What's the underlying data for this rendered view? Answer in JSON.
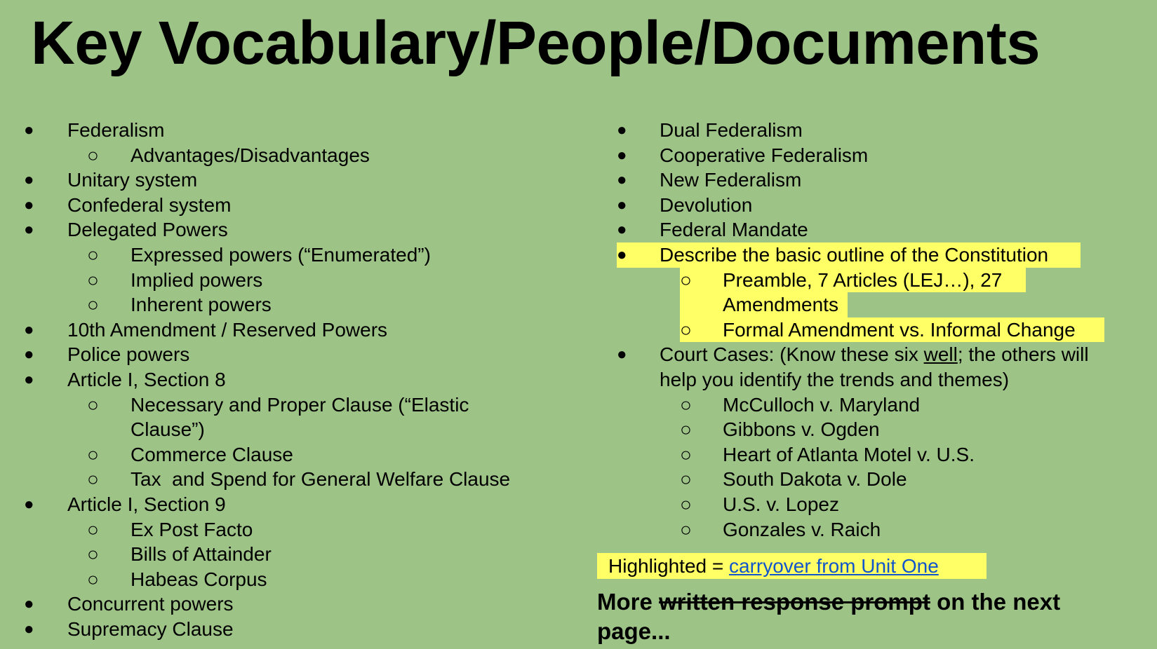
{
  "title": "Key Vocabulary/People/Documents",
  "colors": {
    "background": "#9dc386",
    "highlight": "#ffff66",
    "link": "#1155cc"
  },
  "bullets": {
    "level1": "●",
    "level2": "○"
  },
  "left_column": [
    {
      "level": 1,
      "text": "Federalism"
    },
    {
      "level": 2,
      "text": "Advantages/Disadvantages"
    },
    {
      "level": 1,
      "text": "Unitary system"
    },
    {
      "level": 1,
      "text": "Confederal system"
    },
    {
      "level": 1,
      "text": "Delegated Powers"
    },
    {
      "level": 2,
      "text": "Expressed powers (“Enumerated”)"
    },
    {
      "level": 2,
      "text": "Implied powers"
    },
    {
      "level": 2,
      "text": "Inherent powers"
    },
    {
      "level": 1,
      "text": "10th Amendment / Reserved Powers"
    },
    {
      "level": 1,
      "text": "Police powers"
    },
    {
      "level": 1,
      "text": "Article I, Section 8"
    },
    {
      "level": 2,
      "text": "Necessary and Proper Clause (“Elastic",
      "text2": "Clause”)"
    },
    {
      "level": 2,
      "text": "Commerce Clause"
    },
    {
      "level": 2,
      "text": "Tax  and Spend for General Welfare Clause"
    },
    {
      "level": 1,
      "text": "Article I, Section 9"
    },
    {
      "level": 2,
      "text": "Ex Post Facto"
    },
    {
      "level": 2,
      "text": "Bills of Attainder"
    },
    {
      "level": 2,
      "text": "Habeas Corpus"
    },
    {
      "level": 1,
      "text": "Concurrent powers"
    },
    {
      "level": 1,
      "text": "Supremacy Clause"
    }
  ],
  "right_column": {
    "items": [
      "Dual Federalism",
      "Cooperative Federalism",
      "New Federalism",
      "Devolution",
      "Federal Mandate"
    ],
    "highlighted_item": "Describe the basic outline of the Constitution",
    "highlighted_sub_1_line1": "Preamble, 7 Articles (LEJ…), 27",
    "highlighted_sub_1_line2": "Amendments",
    "highlighted_sub_2": "Formal Amendment vs. Informal Change",
    "court_cases_prefix": "Court Cases: (Know these six ",
    "court_cases_emphasis": "well",
    "court_cases_suffix": "; the others will",
    "court_cases_line2": "help you identify the trends and themes)",
    "cases": [
      "McCulloch v. Maryland",
      "Gibbons v. Ogden",
      "Heart of Atlanta Motel v. U.S.",
      "South Dakota v. Dole",
      "U.S. v. Lopez",
      "Gonzales v. Raich"
    ]
  },
  "legend": {
    "prefix": "Highlighted = ",
    "link_text": "carryover from Unit One"
  },
  "footer": {
    "more": "More ",
    "struck": "written response prompt",
    "rest": " on the next",
    "line2": "page..."
  }
}
